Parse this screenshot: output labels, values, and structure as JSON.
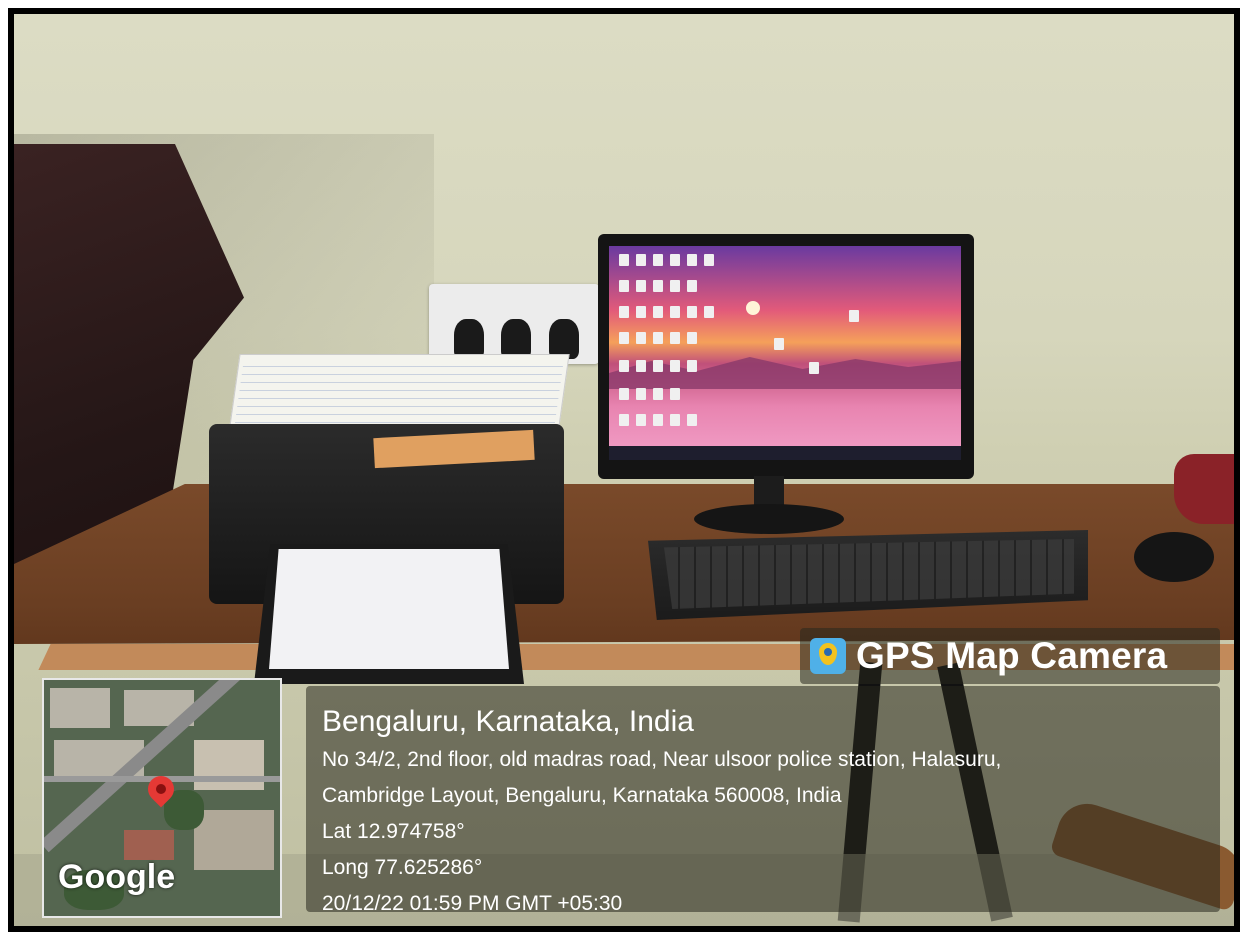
{
  "overlay": {
    "brand": {
      "label": "GPS Map Camera",
      "icon": "gps-map-camera-app-icon"
    },
    "location": {
      "city": "Bengaluru, Karnataka, India",
      "address_line1": "No 34/2, 2nd floor, old madras road, Near ulsoor police station, Halasuru,",
      "address_line2": "Cambridge Layout, Bengaluru, Karnataka 560008, India",
      "latitude": "Lat 12.974758°",
      "longitude": "Long 77.625286°",
      "datetime": "20/12/22 01:59 PM GMT +05:30"
    },
    "map": {
      "provider_logo": "Google",
      "pin_icon": "map-pin-icon",
      "pin_color": "#e53935"
    }
  },
  "colors": {
    "overlay_bg": "#28281e",
    "text": "#ffffff",
    "desk": "#7a4a2a",
    "wall": "#d6d6bc"
  }
}
